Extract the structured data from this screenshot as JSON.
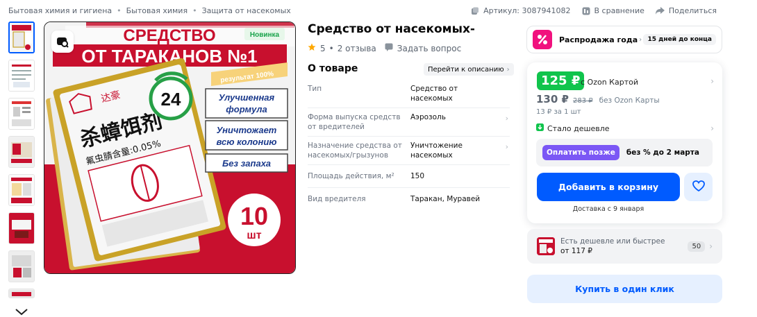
{
  "breadcrumbs": [
    "Бытовая химия и гигиена",
    "Бытовая химия",
    "Защита от насекомых"
  ],
  "header_right": {
    "article": "Артикул: 3087941082",
    "compare": "В сравнение",
    "share": "Поделиться"
  },
  "product": {
    "title": "Средство от насекомых-",
    "rating": "5",
    "reviews": "2 отзыва",
    "ask": "Задать вопрос"
  },
  "image_text": {
    "line1": "СРЕДСТВО",
    "line2": "ОТ ТАРАКАНОВ №1",
    "badge": "Новинка",
    "ribbon": "результат 100%",
    "hours": "24",
    "feat1a": "Улучшенная",
    "feat1b": "формула",
    "feat2a": "Уничтожает",
    "feat2b": "всю колонию",
    "feat3": "Без запаха",
    "pack_cn1": "杀蟑饵剂",
    "pack_cn2": "氟虫腈含量:0.05%",
    "pack_brand": "达豪",
    "count": "10",
    "count_unit": "шт"
  },
  "about": {
    "heading": "О товаре",
    "goto_desc": "Перейти к описанию",
    "specs": [
      {
        "key": "Тип",
        "value": "Средство от насекомых"
      },
      {
        "key": "Форма выпуска средств от вредителей",
        "value": "Аэрозоль"
      },
      {
        "key": "Назначение средства от насекомых/грызунов",
        "value": "Уничтожение насекомых"
      },
      {
        "key": "Площадь действия, м²",
        "value": "150"
      },
      {
        "key": "Вид вредителя",
        "value": "Таракан, Муравей"
      }
    ]
  },
  "sale": {
    "label": "Распродажа года",
    "days_left": "15 дней до конца"
  },
  "price": {
    "ozon_price": "125 ₽",
    "ozon_label": "с Ozon Картой",
    "regular_price": "130 ₽",
    "old_price": "283 ₽",
    "regular_label": "без Ozon Карты",
    "per_unit": "13 ₽ за 1 шт",
    "cheaper": "Стало дешевле",
    "pay_later_btn": "Оплатить позже",
    "pay_later_text": "без % до 2 марта",
    "add_to_cart": "Добавить в корзину",
    "delivery": "Доставка с 9 января"
  },
  "cheaper_offer": {
    "line1": "Есть дешевле или быстрее",
    "line2": "от 117 ₽",
    "count": "50"
  },
  "one_click": "Купить в один клик",
  "colors": {
    "accent": "#005bff",
    "ozon_green": "#10c44c",
    "pay_later": "#7b57f5",
    "sale_pink": "#f1117e",
    "product_red": "#c8102e"
  }
}
